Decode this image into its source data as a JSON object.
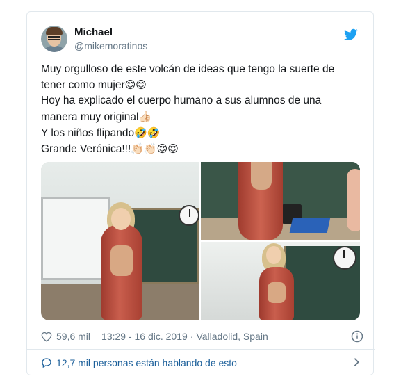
{
  "tweet": {
    "author": {
      "name": "Michael",
      "handle": "@mikemoratinos",
      "avatar_icon": "profile-photo"
    },
    "brand_icon": "twitter-bird-icon",
    "brand_color": "#1da1f2",
    "text_lines": [
      "Muy orgulloso de este volcán de ideas que tengo la suerte de",
      "tener como mujer",
      "Hoy ha explicado el cuerpo humano a sus alumnos de una",
      "manera muy original",
      "Y los niños flipando",
      "Grande Verónica!!!"
    ],
    "emoji": {
      "line2": "😊😊",
      "line4": "👍🏻",
      "line5": "🤣🤣",
      "line6": "👏🏻👏🏻😍😍"
    },
    "media": {
      "photos": [
        "classroom-photo-1",
        "classroom-photo-2",
        "classroom-photo-3"
      ]
    },
    "likes": "59,6 mil",
    "timestamp": "13:29 - 16 dic. 2019",
    "location": "Valladolid, Spain",
    "conversation_text": "12,7 mil personas están hablando de esto",
    "link_color": "#1b5f9a",
    "secondary_text_color": "#657786"
  }
}
